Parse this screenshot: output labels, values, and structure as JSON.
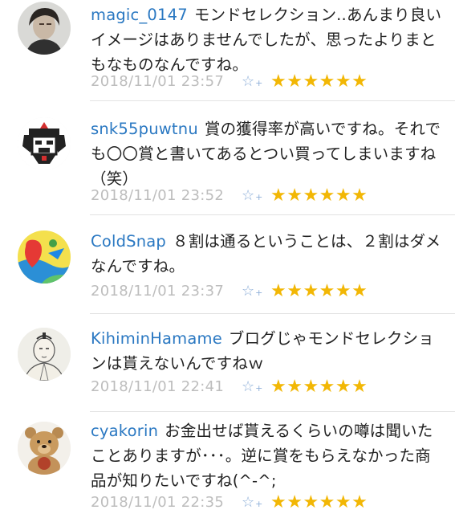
{
  "comments": [
    {
      "user": "magic_0147",
      "text": "モンドセレクション..あんまり良いイメージはありませんでしたが、思ったよりまともなものなんですね。",
      "time": "2018/11/01 23:57",
      "fav_icon": "☆",
      "fav_plus": "+",
      "stars": "★★★★★★",
      "avatar_icon": "person-photo"
    },
    {
      "user": "snk55puwtnu",
      "text": "賞の獲得率が高いですね。それでも〇〇賞と書いてあるとつい買ってしまいますね（笑）",
      "time": "2018/11/01 23:52",
      "fav_icon": "☆",
      "fav_plus": "+",
      "stars": "★★★★★★",
      "avatar_icon": "robot-avatar"
    },
    {
      "user": "ColdSnap",
      "text": "８割は通るということは、２割はダメなんですね。",
      "time": "2018/11/01 23:37",
      "fav_icon": "☆",
      "fav_plus": "+",
      "stars": "★★★★★★",
      "avatar_icon": "colorful-logo"
    },
    {
      "user": "KihiminHamame",
      "text": "ブログじゃモンドセレクションは貰えないんですねｗ",
      "time": "2018/11/01 22:41",
      "fav_icon": "☆",
      "fav_plus": "+",
      "stars": "★★★★★★",
      "avatar_icon": "sketch-portrait"
    },
    {
      "user": "cyakorin",
      "text": "お金出せば貰えるくらいの噂は聞いたことありますが･･･。逆に賞をもらえなかった商品が知りたいですね(^-^;",
      "time": "2018/11/01 22:35",
      "fav_icon": "☆",
      "fav_plus": "+",
      "stars": "★★★★★★",
      "avatar_icon": "teddy-bear"
    }
  ]
}
